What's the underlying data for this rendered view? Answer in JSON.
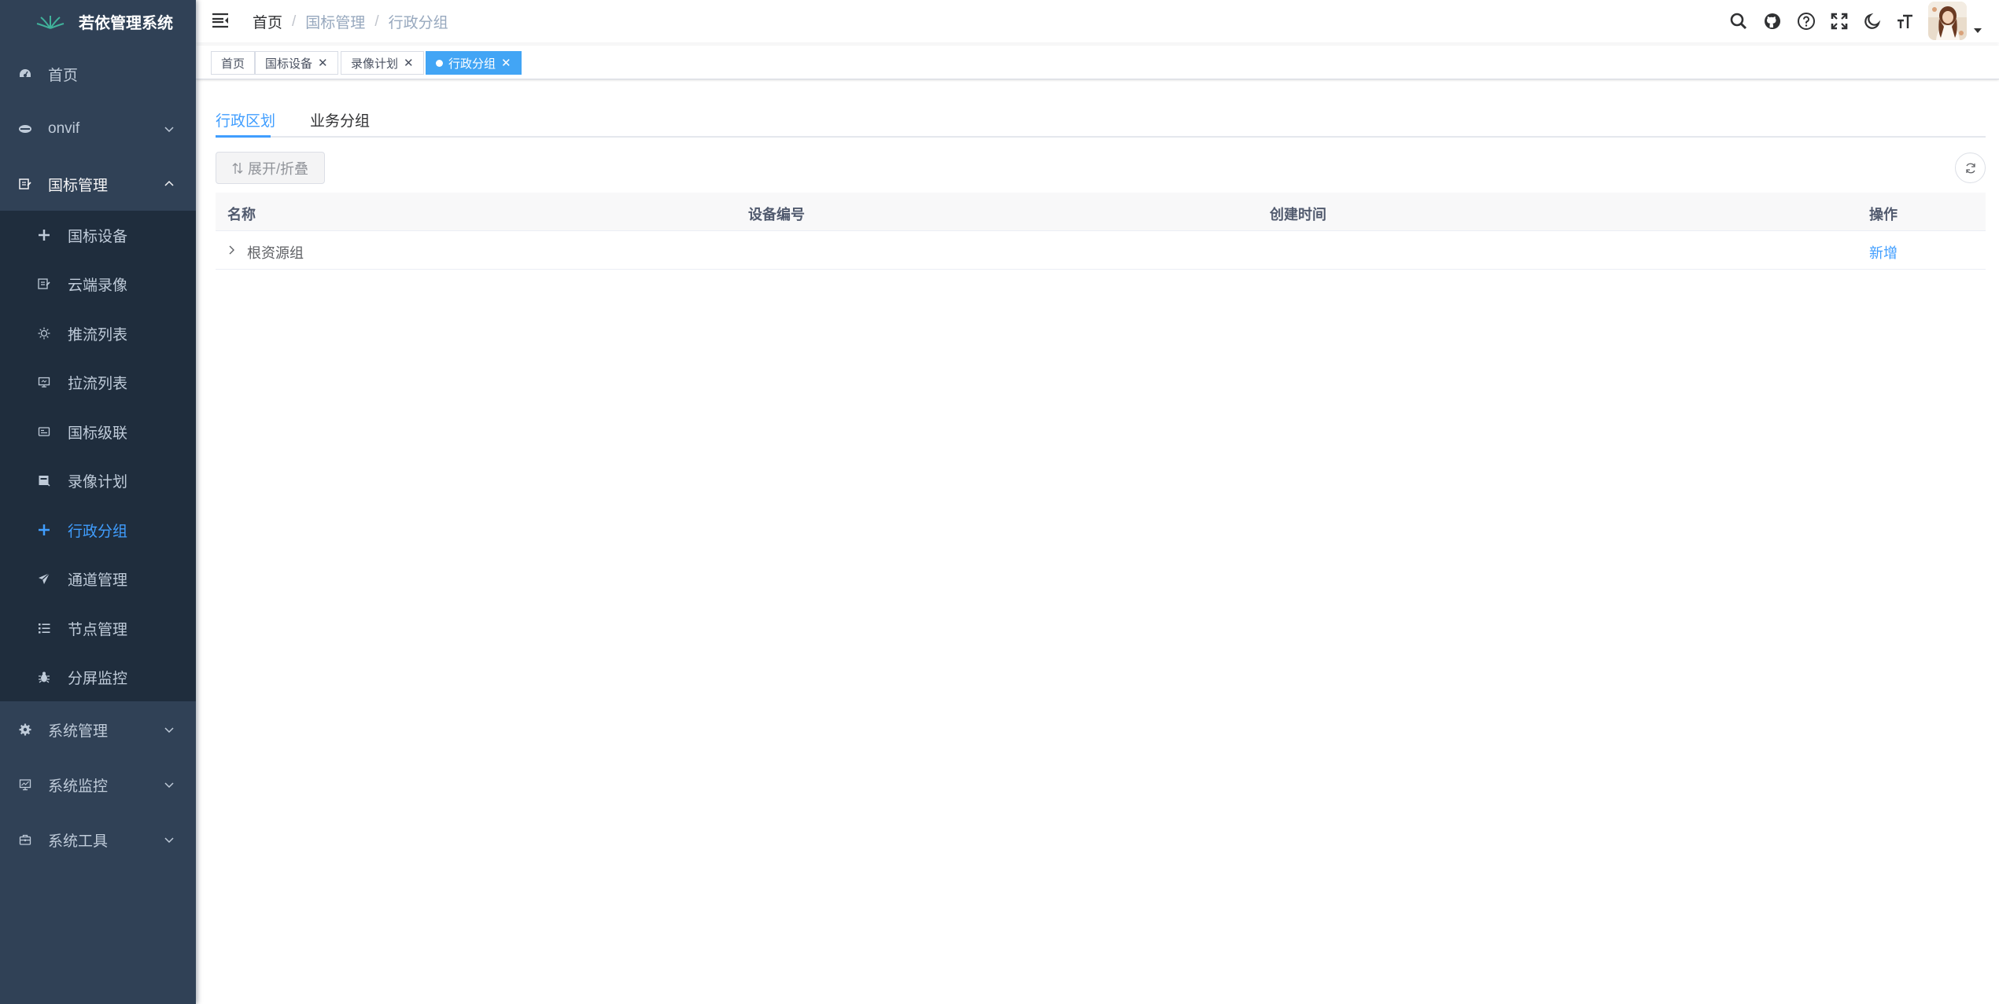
{
  "app": {
    "title": "若依管理系统"
  },
  "sidebar": {
    "items": [
      {
        "label": "首页",
        "icon": "dashboard-icon"
      },
      {
        "label": "onvif",
        "icon": "onvif-icon"
      },
      {
        "label": "国标管理",
        "icon": "gb-icon"
      }
    ],
    "subitems": [
      {
        "label": "国标设备",
        "icon": "cross-icon"
      },
      {
        "label": "云端录像",
        "icon": "cloud-record-icon"
      },
      {
        "label": "推流列表",
        "icon": "sun-icon"
      },
      {
        "label": "拉流列表",
        "icon": "monitor-icon"
      },
      {
        "label": "国标级联",
        "icon": "cascade-icon"
      },
      {
        "label": "录像计划",
        "icon": "calendar-icon"
      },
      {
        "label": "行政分组",
        "icon": "cross-icon"
      },
      {
        "label": "通道管理",
        "icon": "send-icon"
      },
      {
        "label": "节点管理",
        "icon": "list-icon"
      },
      {
        "label": "分屏监控",
        "icon": "bug-icon"
      }
    ],
    "bottom": [
      {
        "label": "系统管理",
        "icon": "gear-icon"
      },
      {
        "label": "系统监控",
        "icon": "monitor-chart-icon"
      },
      {
        "label": "系统工具",
        "icon": "toolbox-icon"
      }
    ]
  },
  "breadcrumb": [
    "首页",
    "国标管理",
    "行政分组"
  ],
  "tags": [
    {
      "label": "首页"
    },
    {
      "label": "国标设备"
    },
    {
      "label": "录像计划"
    },
    {
      "label": "行政分组"
    }
  ],
  "tabs": [
    "行政区划",
    "业务分组"
  ],
  "toolbar": {
    "expand_label": "展开/折叠"
  },
  "table": {
    "headers": [
      "名称",
      "设备编号",
      "创建时间",
      "操作"
    ],
    "rows": [
      {
        "name": "根资源组",
        "code": "",
        "time": "",
        "action": "新增"
      }
    ]
  }
}
